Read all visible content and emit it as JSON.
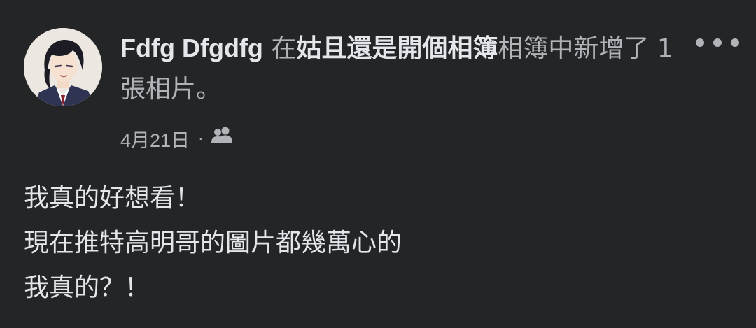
{
  "post": {
    "author": "Fdfg Dfgdfg",
    "action_prefix": " 在",
    "album_name": "姑且還是開個相簿",
    "action_suffix": "相簿中新增了 1 張相片。",
    "date": "4月21日",
    "separator": "·",
    "privacy_icon": "friends-icon",
    "more_icon": "more-options-icon",
    "body_lines": [
      "我真的好想看！",
      "現在推特高明哥的圖片都幾萬心的",
      "我真的？！"
    ]
  },
  "colors": {
    "background": "#242526",
    "primary_text": "#e4e6eb",
    "secondary_text": "#b0b3b8"
  }
}
